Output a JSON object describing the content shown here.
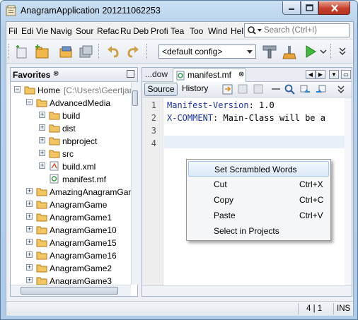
{
  "window": {
    "title": "AnagramApplication 201211062253",
    "min_label": "—",
    "max_label": "☐",
    "close_label": "✕"
  },
  "menu": [
    "File",
    "Edit",
    "View",
    "Navigate",
    "Source",
    "Refactor",
    "Run",
    "Debug",
    "Profile",
    "Team",
    "Tools",
    "Window",
    "Help"
  ],
  "menu_display": [
    "Fil",
    "Edi",
    "Vie",
    "Navig",
    "Sour",
    "Refac",
    "Ru",
    "Deb",
    "Profi",
    "Tea",
    "Too",
    "Wind",
    "Hel"
  ],
  "search": {
    "placeholder": "Search (Ctrl+I)"
  },
  "toolbar": {
    "config_value": "<default config>",
    "icons": [
      "new-file-icon",
      "new-project-icon",
      "open-project-icon",
      "save-all-icon",
      "undo-icon",
      "redo-icon",
      "build-icon",
      "clean-build-icon",
      "run-icon",
      "more-icon"
    ]
  },
  "favorites": {
    "title": "Favorites",
    "close": "⊗",
    "tree": [
      {
        "label": "Home",
        "suffix": "[C:\\Users\\Geertjan",
        "depth": 0,
        "expander": "−",
        "icon": "folder"
      },
      {
        "label": "AdvancedMedia",
        "depth": 1,
        "expander": "−",
        "icon": "folder"
      },
      {
        "label": "build",
        "depth": 2,
        "expander": "+",
        "icon": "folder"
      },
      {
        "label": "dist",
        "depth": 2,
        "expander": "+",
        "icon": "folder"
      },
      {
        "label": "nbproject",
        "depth": 2,
        "expander": "+",
        "icon": "folder"
      },
      {
        "label": "src",
        "depth": 2,
        "expander": "+",
        "icon": "folder"
      },
      {
        "label": "build.xml",
        "depth": 2,
        "expander": "+",
        "icon": "xml"
      },
      {
        "label": "manifest.mf",
        "depth": 2,
        "expander": "",
        "icon": "manifest"
      },
      {
        "label": "AmazingAnagramGam",
        "depth": 1,
        "expander": "+",
        "icon": "folder"
      },
      {
        "label": "AnagramGame",
        "depth": 1,
        "expander": "+",
        "icon": "folder"
      },
      {
        "label": "AnagramGame1",
        "depth": 1,
        "expander": "+",
        "icon": "folder"
      },
      {
        "label": "AnagramGame10",
        "depth": 1,
        "expander": "+",
        "icon": "folder"
      },
      {
        "label": "AnagramGame15",
        "depth": 1,
        "expander": "+",
        "icon": "folder"
      },
      {
        "label": "AnagramGame16",
        "depth": 1,
        "expander": "+",
        "icon": "folder"
      },
      {
        "label": "AnagramGame2",
        "depth": 1,
        "expander": "+",
        "icon": "folder"
      },
      {
        "label": "AnagramGame3",
        "depth": 1,
        "expander": "+",
        "icon": "folder"
      }
    ]
  },
  "editor": {
    "prev_tab": "...dow",
    "tab_label": "manifest.mf",
    "tab_close": "⊗",
    "source_label": "Source",
    "history_label": "History",
    "lines": [
      {
        "num": "1",
        "key": "Manifest-Version",
        "value": ": 1.0"
      },
      {
        "num": "2",
        "key": "X-COMMENT",
        "value": ": Main-Class will be a"
      },
      {
        "num": "3",
        "key": "",
        "value": ""
      },
      {
        "num": "4",
        "key": "",
        "value": ""
      }
    ]
  },
  "context_menu": [
    {
      "label": "Set Scrambled Words",
      "shortcut": ""
    },
    {
      "label": "Cut",
      "shortcut": "Ctrl+X"
    },
    {
      "label": "Copy",
      "shortcut": "Ctrl+C"
    },
    {
      "label": "Paste",
      "shortcut": "Ctrl+V"
    },
    {
      "label": "Select in Projects",
      "shortcut": ""
    }
  ],
  "status": {
    "position": "4 | 1",
    "mode": "INS"
  },
  "colors": {
    "keyword": "#1a32a8",
    "close_button": "#c7402b",
    "title_bar": "#c9dff3"
  }
}
